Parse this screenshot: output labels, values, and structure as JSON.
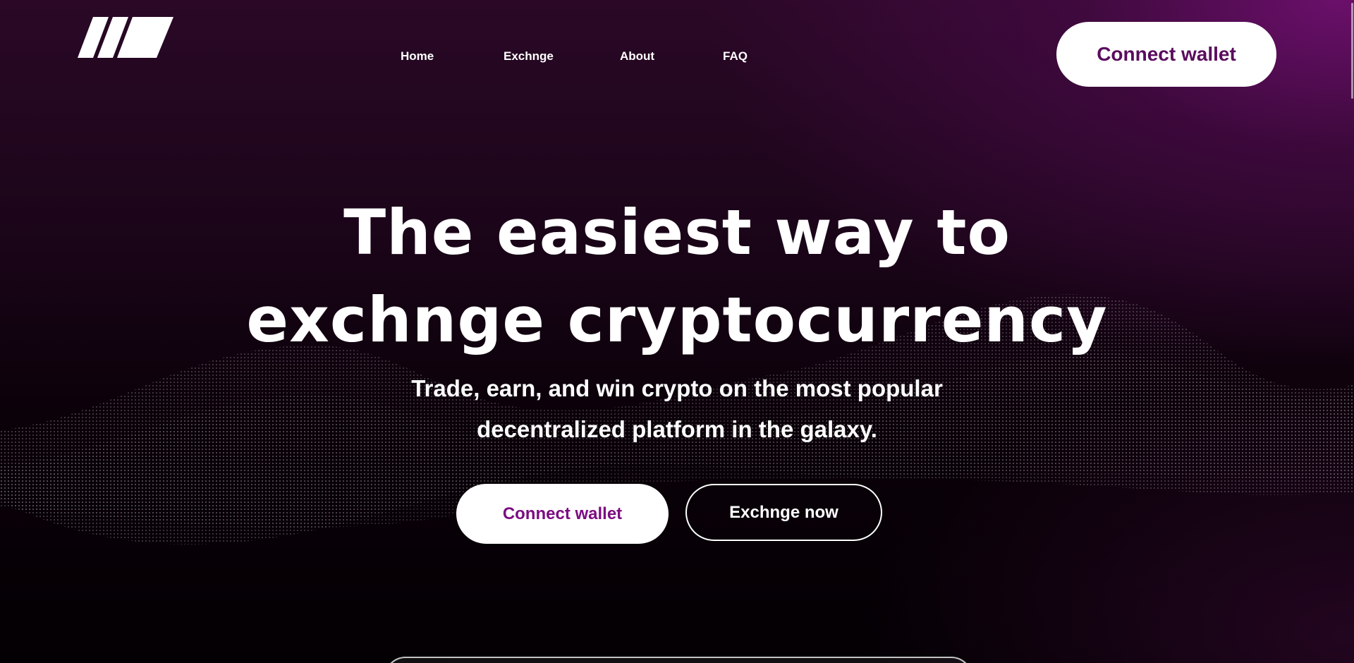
{
  "nav": {
    "logo_icon": "brand-logo-slashes",
    "links": [
      "Home",
      "Exchnge",
      "About",
      "FAQ"
    ],
    "connect_label": "Connect wallet"
  },
  "hero": {
    "title_line1": "The easiest way to",
    "title_line2": "exchnge cryptocurrency",
    "subtitle_line1": "Trade, earn, and win crypto on the most popular",
    "subtitle_line2": "decentralized platform in the galaxy.",
    "connect_label": "Connect wallet",
    "exchange_label": "Exchnge now"
  },
  "colors": {
    "accent": "#7c0b82",
    "accent_dark": "#5a0c5e",
    "background_top": "#2a0826",
    "background_glow": "#6e106e",
    "background_bottom": "#030003"
  }
}
